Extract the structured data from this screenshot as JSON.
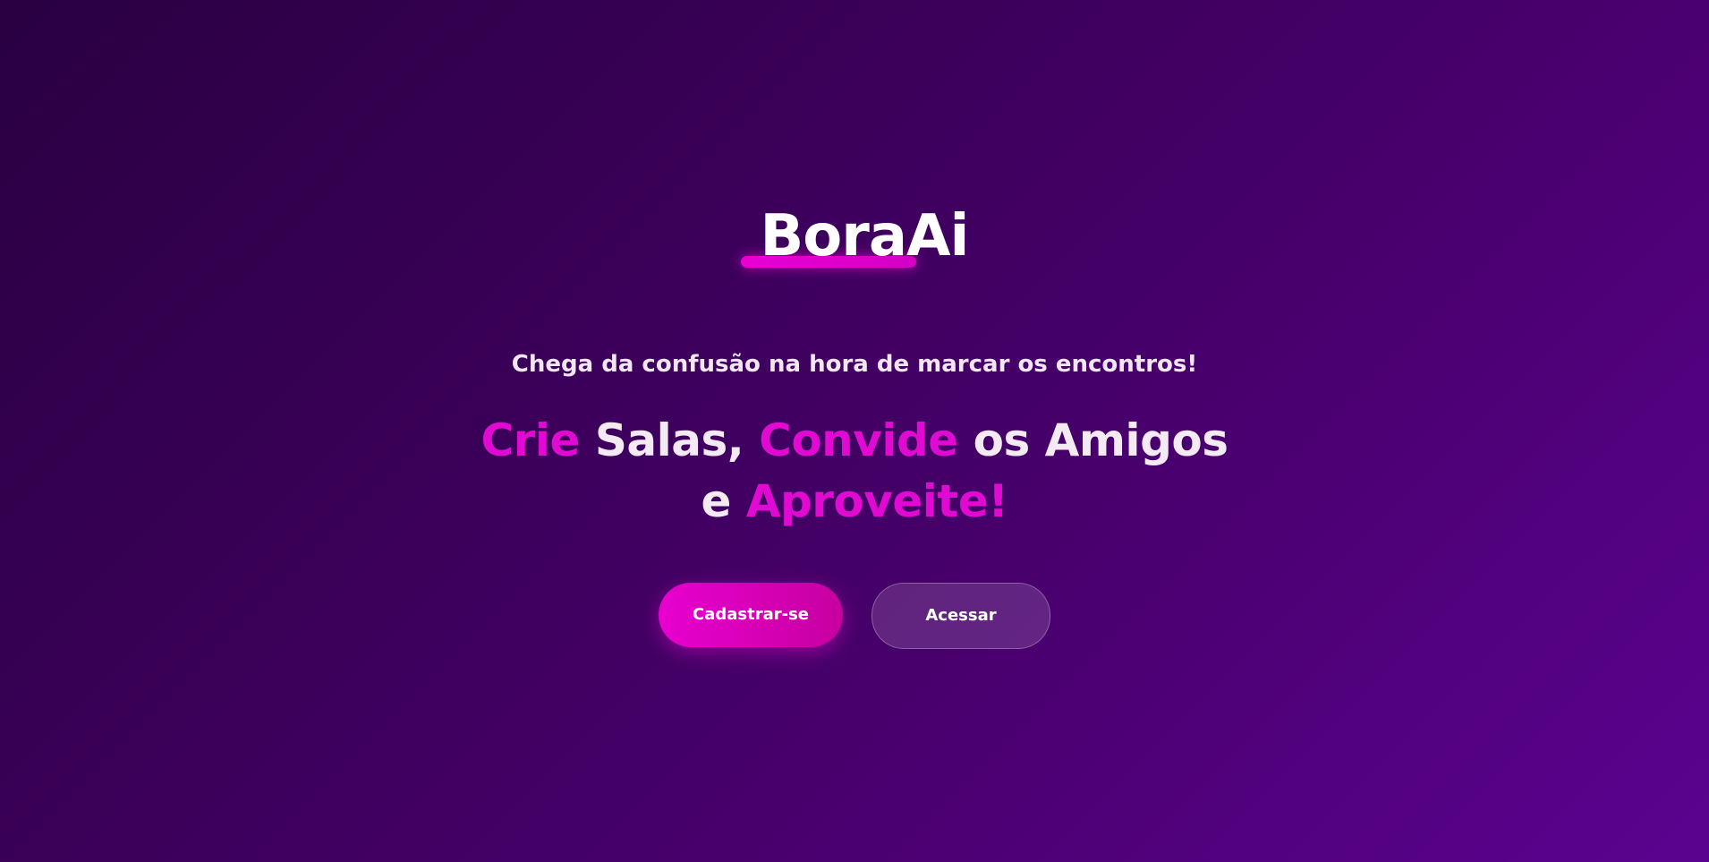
{
  "brand": {
    "logo_text": "BoraAi"
  },
  "hero": {
    "tagline": "Chega da confusão na hora de marcar os encontros!",
    "headline": {
      "line1": [
        {
          "text": "Crie",
          "accent": true
        },
        {
          "text": " Salas, ",
          "accent": false
        },
        {
          "text": "Convide",
          "accent": true
        },
        {
          "text": " os Amigos",
          "accent": false
        }
      ],
      "line2": [
        {
          "text": "e ",
          "accent": false
        },
        {
          "text": "Aproveite!",
          "accent": true
        }
      ]
    }
  },
  "actions": {
    "signup_label": "Cadastrar-se",
    "login_label": "Acessar"
  },
  "colors": {
    "accent": "#e00ad2",
    "background_start": "#2a0042",
    "background_end": "#5a0390",
    "text_light": "#f3eaf4"
  }
}
